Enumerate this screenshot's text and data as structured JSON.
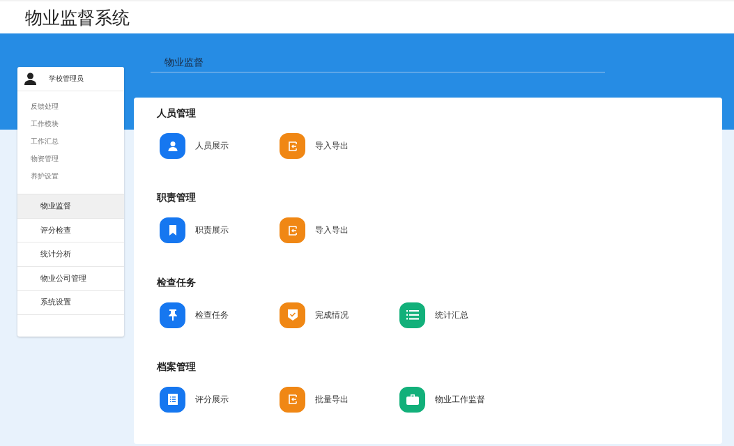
{
  "app_title": "物业监督系统",
  "sidebar": {
    "user": "学校管理员",
    "links": [
      "反馈处理",
      "工作模块",
      "工作汇总",
      "物资管理",
      "养护设置"
    ],
    "menu": [
      {
        "label": "物业监督",
        "selected": true
      },
      {
        "label": "评分检查",
        "selected": false
      },
      {
        "label": "统计分析",
        "selected": false
      },
      {
        "label": "物业公司管理",
        "selected": false
      },
      {
        "label": "系统设置",
        "selected": false
      }
    ]
  },
  "page_tab": "物业监督",
  "sections": [
    {
      "title": "人员管理",
      "items": [
        {
          "label": "人员展示",
          "kind": "user",
          "color": "#1677f0"
        },
        {
          "label": "导入导出",
          "kind": "export",
          "color": "#f08714"
        }
      ]
    },
    {
      "title": "职责管理",
      "items": [
        {
          "label": "职责展示",
          "kind": "bookmark",
          "color": "#1677f0"
        },
        {
          "label": "导入导出",
          "kind": "export",
          "color": "#f08714"
        }
      ]
    },
    {
      "title": "检查任务",
      "items": [
        {
          "label": "检查任务",
          "kind": "pin",
          "color": "#1677f0"
        },
        {
          "label": "完成情况",
          "kind": "shield",
          "color": "#f08714"
        },
        {
          "label": "统计汇总",
          "kind": "numbered-list",
          "color": "#12b07a"
        }
      ]
    },
    {
      "title": "档案管理",
      "items": [
        {
          "label": "评分展示",
          "kind": "list-sheet",
          "color": "#1677f0"
        },
        {
          "label": "批量导出",
          "kind": "export",
          "color": "#f08714"
        },
        {
          "label": "物业工作监督",
          "kind": "briefcase",
          "color": "#12b07a"
        }
      ]
    }
  ]
}
